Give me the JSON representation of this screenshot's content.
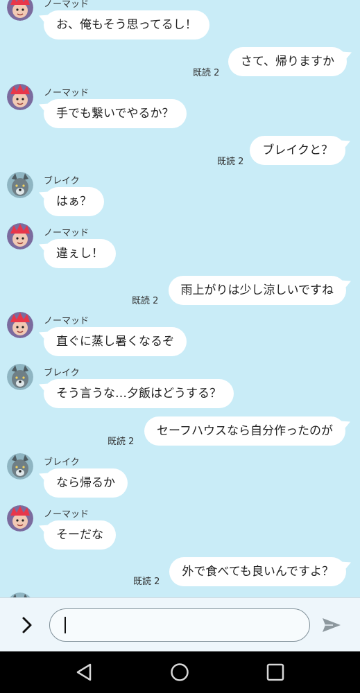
{
  "messages": [
    {
      "side": "left",
      "sender": "ノーマッド",
      "avatar": "nomad-avatar",
      "text": "お、俺もそう思ってるし！"
    },
    {
      "side": "right",
      "read": "既読 2",
      "text": "さて、帰りますか"
    },
    {
      "side": "left",
      "sender": "ノーマッド",
      "avatar": "nomad-avatar",
      "text": "手でも繋いでやるか？"
    },
    {
      "side": "right",
      "read": "既読 2",
      "text": "ブレイクと？"
    },
    {
      "side": "left",
      "sender": "ブレイク",
      "avatar": "blake-avatar",
      "text": "はぁ？"
    },
    {
      "side": "left",
      "sender": "ノーマッド",
      "avatar": "nomad-avatar",
      "text": "違ぇし！"
    },
    {
      "side": "right",
      "read": "既読 2",
      "text": "雨上がりは少し涼しいですね"
    },
    {
      "side": "left",
      "sender": "ノーマッド",
      "avatar": "nomad-avatar",
      "text": "直ぐに蒸し暑くなるぞ"
    },
    {
      "side": "left",
      "sender": "ブレイク",
      "avatar": "blake-avatar",
      "text": "そう言うな…夕飯はどうする？"
    },
    {
      "side": "right",
      "read": "既読 2",
      "text": "セーフハウスなら自分作ったのが"
    },
    {
      "side": "left",
      "sender": "ブレイク",
      "avatar": "blake-avatar",
      "text": "なら帰るか"
    },
    {
      "side": "left",
      "sender": "ノーマッド",
      "avatar": "nomad-avatar",
      "text": "そーだな"
    },
    {
      "side": "right",
      "read": "既読 2",
      "text": "外で食べても良いんですよ？"
    }
  ],
  "input": {
    "placeholder": "",
    "value": ""
  },
  "icons": {
    "expand": "chevron-right-icon",
    "send": "send-icon",
    "back": "nav-back-icon",
    "home": "nav-home-icon",
    "recents": "nav-recents-icon"
  },
  "colors": {
    "background": "#c9ecf7",
    "bubble": "#ffffff",
    "nomad_hair": "#e8374a",
    "blake_fur": "#6f7f86"
  }
}
